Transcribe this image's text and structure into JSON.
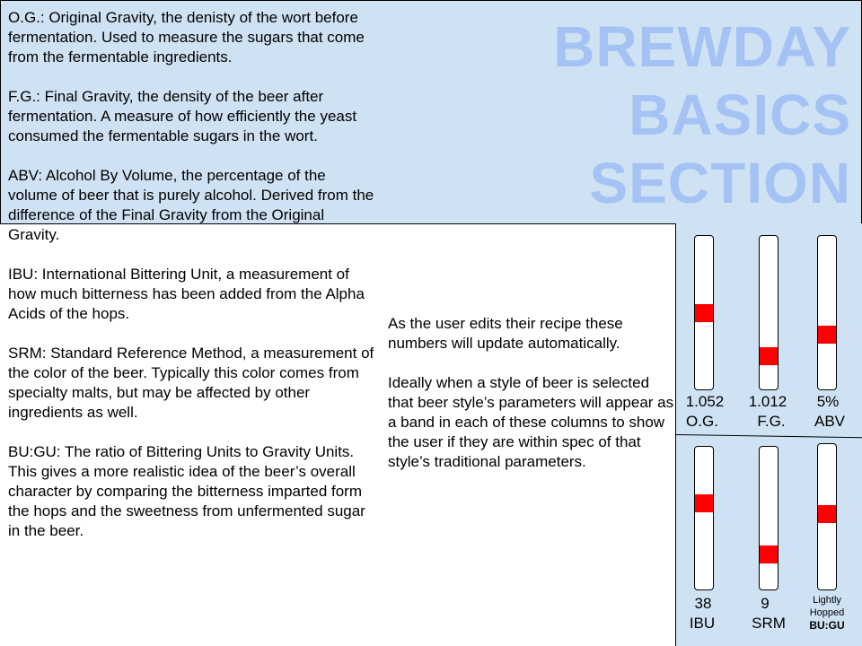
{
  "title": [
    "BREWDAY",
    "BASICS",
    "SECTION"
  ],
  "definitions": [
    "O.G.: Original Gravity, the denisty of the wort before fermentation.  Used to measure the sugars that come from the fermentable ingredients.",
    "F.G.: Final Gravity, the density of the beer after fermentation.  A measure of how efficiently the yeast consumed the fermentable sugars in the wort.",
    "ABV: Alcohol By Volume, the percentage of the volume of beer that is purely alcohol.  Derived from the difference of the Final Gravity from the Original Gravity.",
    "IBU: International Bittering Unit, a measurement of how much bitterness has been added from the Alpha Acids of the hops.",
    "SRM: Standard Reference Method, a measurement of the color of the beer.  Typically this color comes from specialty malts, but may be affected by other ingredients as well.",
    "BU:GU: The ratio of Bittering Units to Gravity Units.  This gives a more realistic idea of the beer’s overall character by comparing the bitterness imparted form the hops and the sweetness from unfermented sugar in the beer."
  ],
  "notes": [
    "As the user edits their recipe these numbers will update automatically.",
    "Ideally when a style of beer is selected that beer style’s parameters will appear as a band in each of these columns to show the user if they are within spec of that style’s traditional parameters."
  ],
  "gauges_top": [
    {
      "id": "og",
      "value": "1.052",
      "label": "O.G.",
      "level": 0.5
    },
    {
      "id": "fg",
      "value": "1.012",
      "label": "F.G.",
      "level": 0.18
    },
    {
      "id": "abv",
      "value": "5%",
      "label": "ABV",
      "level": 0.34
    }
  ],
  "gauges_bottom": [
    {
      "id": "ibu",
      "value": "38",
      "label": "IBU",
      "level": 0.62
    },
    {
      "id": "srm",
      "value": "9",
      "label": "SRM",
      "level": 0.21
    },
    {
      "id": "bugu",
      "value": "Lightly Hopped",
      "label": "BU:GU",
      "level": 0.52
    }
  ],
  "colors": {
    "panel": "#cfe2f3",
    "title": "#a4c2f4",
    "marker": "#ff0000"
  }
}
